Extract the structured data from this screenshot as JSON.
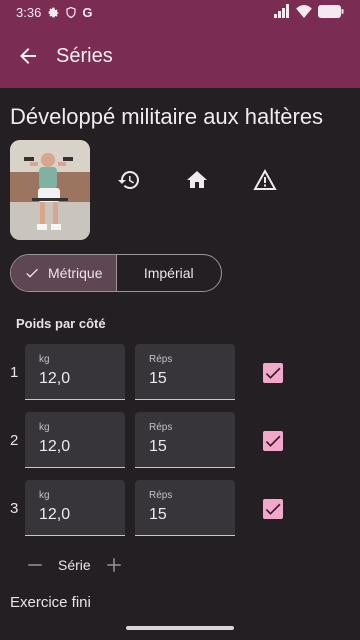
{
  "status_bar": {
    "time": "3:36",
    "left_icons": [
      "settings-icon",
      "shield-icon",
      "google-g-icon"
    ],
    "right_icons": [
      "signal-icon",
      "wifi-icon",
      "battery-icon"
    ],
    "g_letter": "G"
  },
  "app_bar": {
    "title": "Séries",
    "back_icon": "arrow-back-icon"
  },
  "exercise": {
    "title": "Développé militaire aux haltères",
    "actions": [
      "history-icon",
      "home-icon",
      "warning-icon"
    ]
  },
  "unit_toggle": {
    "metric_label": "Métrique",
    "imperial_label": "Impérial",
    "selected": "Métrique"
  },
  "weights_label": "Poids par côté",
  "sets": [
    {
      "number": "1",
      "weight_label": "kg",
      "weight": "12,0",
      "reps_label": "Réps",
      "reps": "15",
      "done": true
    },
    {
      "number": "2",
      "weight_label": "kg",
      "weight": "12,0",
      "reps_label": "Réps",
      "reps": "15",
      "done": true
    },
    {
      "number": "3",
      "weight_label": "kg",
      "weight": "12,0",
      "reps_label": "Réps",
      "reps": "15",
      "done": true
    }
  ],
  "serie_control": {
    "label": "Série",
    "minus": "—",
    "plus": "+"
  },
  "finish_label": "Exercice fini",
  "colors": {
    "primary": "#7a2c52",
    "background": "#231f22",
    "checkbox": "#f1a8cb",
    "field": "#37343a"
  }
}
